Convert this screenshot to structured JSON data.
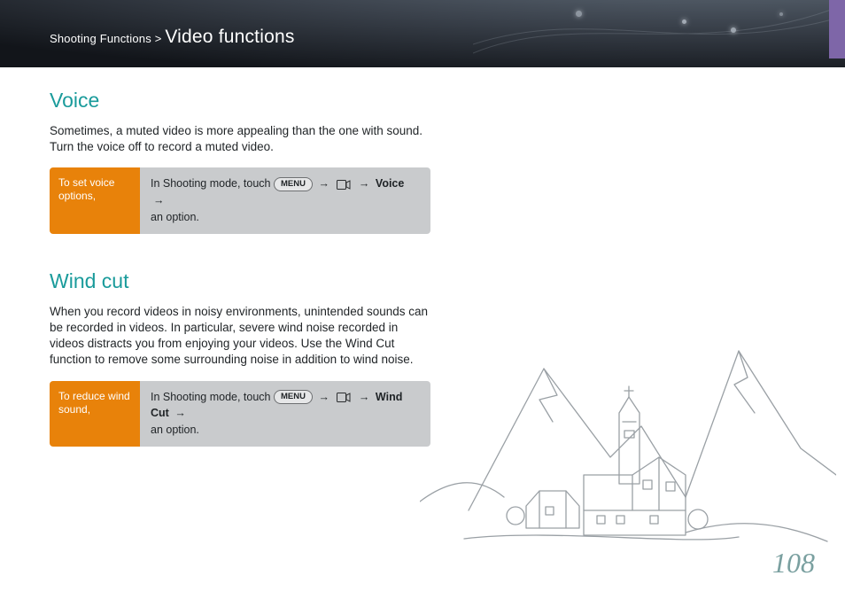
{
  "header": {
    "breadcrumb_parent": "Shooting Functions",
    "breadcrumb_sep": " > ",
    "breadcrumb_current": "Video functions"
  },
  "voice": {
    "heading": "Voice",
    "body": "Sometimes, a muted video is more appealing than the one with sound. Turn the voice off to record a muted video.",
    "callout_left": "To set voice options,",
    "callout_pre": "In Shooting mode, touch ",
    "menu_label": "MENU",
    "arrow": "→",
    "bold_item": "Voice",
    "callout_post": "an option."
  },
  "windcut": {
    "heading": "Wind cut",
    "body": "When you record videos in noisy environments, unintended sounds can be recorded in videos. In particular, severe wind noise recorded in videos distracts you from enjoying your videos. Use the Wind Cut function to remove some surrounding noise in addition to wind noise.",
    "callout_left": "To reduce wind sound,",
    "callout_pre": "In Shooting mode, touch ",
    "menu_label": "MENU",
    "arrow": "→",
    "bold_item": "Wind Cut",
    "callout_post": "an option."
  },
  "page_number": "108"
}
